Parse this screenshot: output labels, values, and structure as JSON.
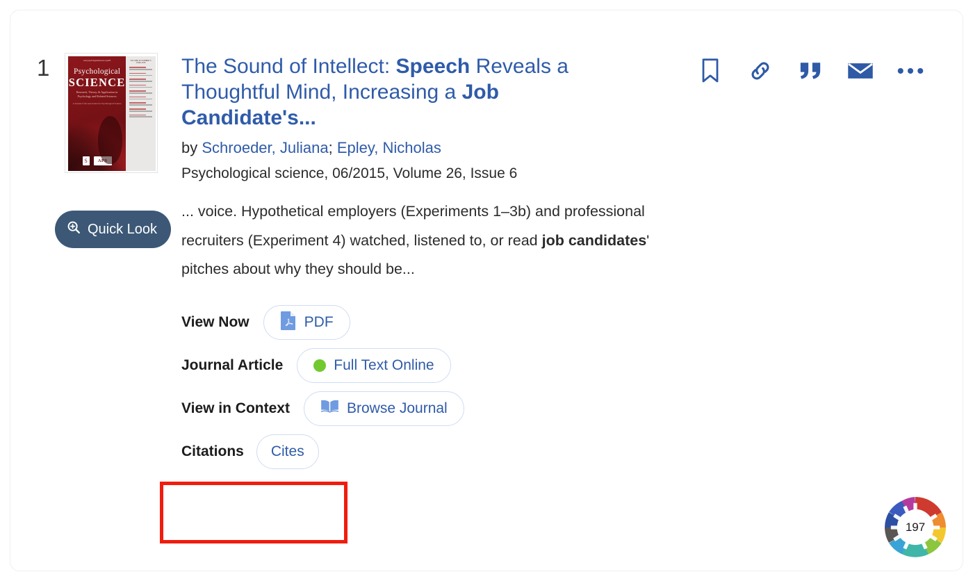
{
  "result": {
    "rank": "1",
    "title_parts": [
      {
        "text": "The Sound of Intellect: ",
        "bold": false
      },
      {
        "text": "Speech",
        "bold": true
      },
      {
        "text": " Reveals a Thoughtful Mind, Increasing a ",
        "bold": false
      },
      {
        "text": "Job",
        "bold": true
      },
      {
        "text": " Candidate's...",
        "bold": true
      }
    ],
    "title_plain": "The Sound of Intellect: Speech Reveals a Thoughtful Mind, Increasing a Job Candidate's...",
    "by_prefix": "by ",
    "authors": [
      "Schroeder, Juliana",
      "Epley, Nicholas"
    ],
    "author_separator": "; ",
    "source_line": "Psychological science, 06/2015, Volume 26, Issue 6",
    "snippet_parts": [
      {
        "text": "... voice. Hypothetical employers (Experiments 1–3b) and professional recruiters (Experiment 4) watched, listened to, or read ",
        "bold": false
      },
      {
        "text": "job candidates",
        "bold": true
      },
      {
        "text": "' pitches about why they should be...",
        "bold": false
      }
    ],
    "snippet_plain": "... voice. Hypothetical employers (Experiments 1–3b) and professional recruiters (Experiment 4) watched, listened to, or read job candidates' pitches about why they should be...",
    "quick_look_label": "Quick Look",
    "quick_look_icon": "magnifier-plus-icon"
  },
  "cover": {
    "url_text": "www.psychologicalscience.org/PS",
    "title_line1": "Psychological",
    "title_line2": "SCIENCE",
    "subtitle": "Research, Theory, & Application in Psychology and Related Sciences",
    "society_line": "A Journal of the Association for Psychological Science",
    "issue_line": "VOLUME 26   NUMBER 6   JUNE 2015",
    "logo_sage": "S",
    "logo_aps": "APS"
  },
  "availability": [
    {
      "label": "View Now",
      "action": "PDF",
      "icon": "pdf-file-icon",
      "name": "pdf"
    },
    {
      "label": "Journal Article",
      "action": "Full Text Online",
      "icon": "green-status-dot-icon",
      "name": "full-text-online"
    },
    {
      "label": "View in Context",
      "action": "Browse Journal",
      "icon": "open-book-icon",
      "name": "browse-journal"
    },
    {
      "label": "Citations",
      "action": "Cites",
      "icon": "none",
      "name": "cites"
    }
  ],
  "actions": [
    {
      "name": "save-to-favorites",
      "icon": "bookmark-icon",
      "label": "Save to favorites"
    },
    {
      "name": "permalink",
      "icon": "link-icon",
      "label": "Permalink"
    },
    {
      "name": "citation",
      "icon": "quote-icon",
      "label": "Citation"
    },
    {
      "name": "email",
      "icon": "envelope-icon",
      "label": "Email"
    },
    {
      "name": "more-options",
      "icon": "ellipsis-icon",
      "label": "More options"
    }
  ],
  "altmetric": {
    "score": "197",
    "label": "Altmetric attention score"
  },
  "colors": {
    "link_blue": "#2f5ba9",
    "quick_look_bg": "#3c5876",
    "pill_border": "#cfdcf3",
    "status_green": "#72c92f",
    "annotation_red": "#f01c0e",
    "cover_red": "#7b1317"
  }
}
